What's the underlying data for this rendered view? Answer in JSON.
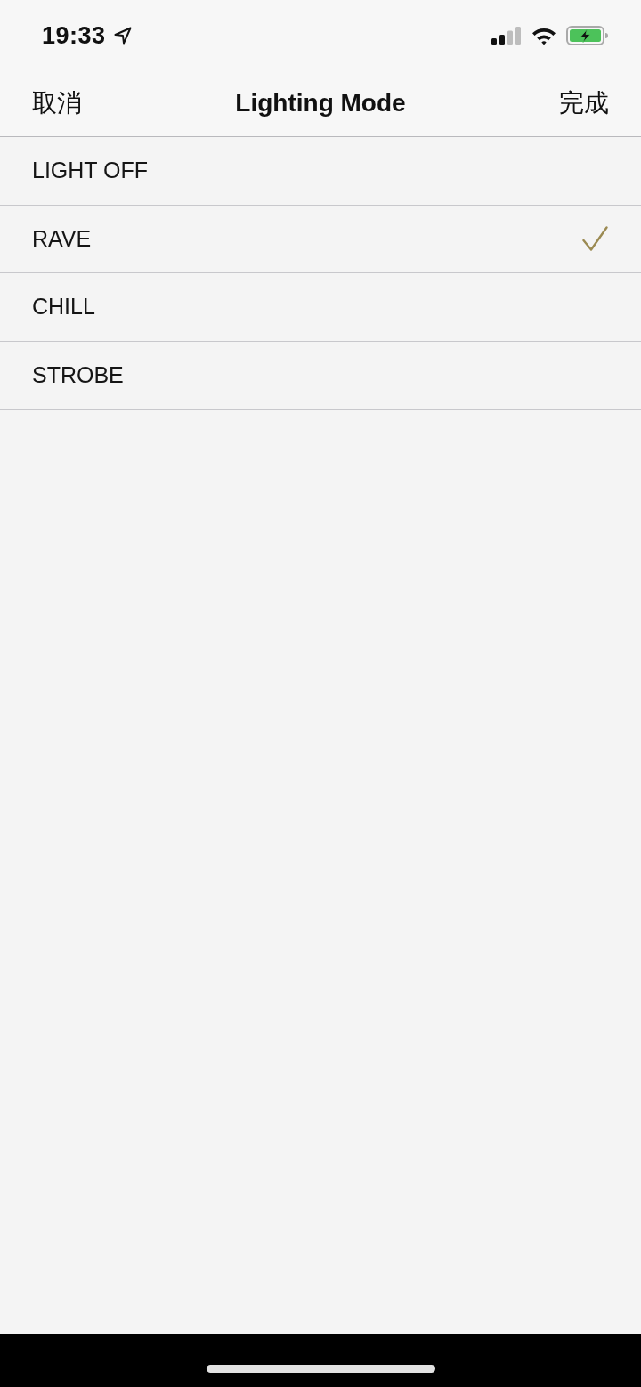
{
  "status_bar": {
    "time": "19:33"
  },
  "nav_bar": {
    "cancel": "取消",
    "title": "Lighting Mode",
    "done": "完成"
  },
  "modes": [
    {
      "label": "LIGHT OFF",
      "selected": false
    },
    {
      "label": "RAVE",
      "selected": true
    },
    {
      "label": "CHILL",
      "selected": false
    },
    {
      "label": "STROBE",
      "selected": false
    }
  ]
}
